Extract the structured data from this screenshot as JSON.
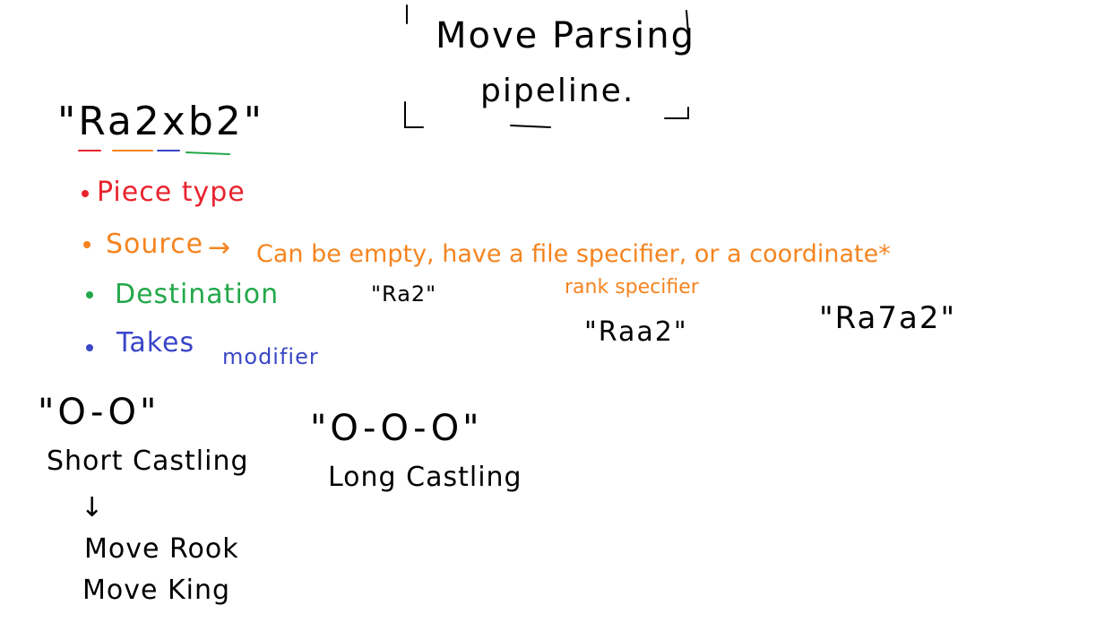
{
  "colors": {
    "ink": "#000000",
    "piece": "#e8232e",
    "source": "#f5841f",
    "destination": "#23a84a",
    "takes": "#3a46c8"
  },
  "title": {
    "line1": "Move Parsing",
    "line2": "pipeline."
  },
  "move": {
    "text": "\"Ra2xb2\""
  },
  "bullets": {
    "piece": "Piece type",
    "source": "Source",
    "source_arrow": "→",
    "source_note": "Can be empty, have a file specifier, or a coordinate*",
    "destination": "Destination",
    "takes": "Takes",
    "takes_note": "modifier"
  },
  "examples": {
    "file": "\"Ra2\"",
    "rank_label": "rank specifier",
    "rank": "\"Raa2\"",
    "coordinate": "\"Ra7a2\""
  },
  "castling": {
    "short_notation": "\"O-O\"",
    "short_label": "Short Castling",
    "arrow": "↓",
    "step1": "Move Rook",
    "step2": "Move King",
    "long_notation": "\"O-O-O\"",
    "long_label": "Long Castling"
  }
}
